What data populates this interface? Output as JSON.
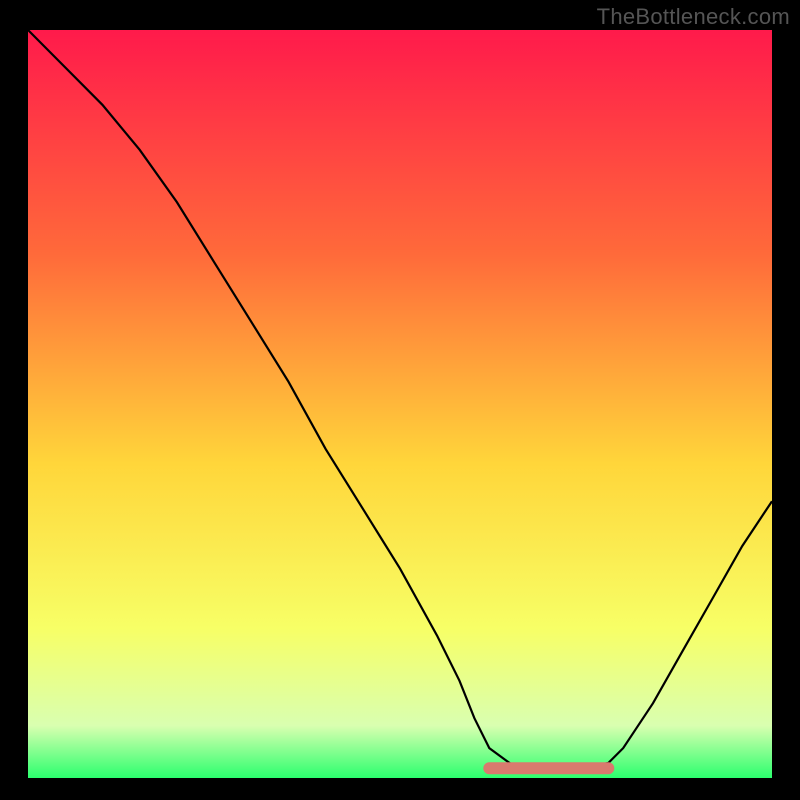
{
  "attribution": "TheBottleneck.com",
  "chart_data": {
    "type": "line",
    "title": "",
    "xlabel": "",
    "ylabel": "",
    "xlim": [
      0,
      100
    ],
    "ylim": [
      0,
      100
    ],
    "background_gradient": {
      "top": "#ff1a4b",
      "upper_mid": "#ff6a3a",
      "mid": "#ffd63a",
      "lower_mid": "#f7ff66",
      "lower": "#d9ffb0",
      "bottom": "#2bff6e"
    },
    "curve_color": "#000000",
    "highlight": {
      "color": "#d97a6e",
      "x_start": 62,
      "x_end": 78,
      "y": 1.3
    },
    "series": [
      {
        "name": "bottleneck-curve",
        "x": [
          0,
          5,
          10,
          15,
          20,
          25,
          30,
          35,
          40,
          45,
          50,
          55,
          58,
          60,
          62,
          65,
          68,
          72,
          75,
          78,
          80,
          84,
          88,
          92,
          96,
          100
        ],
        "y": [
          100,
          95,
          90,
          84,
          77,
          69,
          61,
          53,
          44,
          36,
          28,
          19,
          13,
          8,
          4,
          1.8,
          1.3,
          1.3,
          1.4,
          2,
          4,
          10,
          17,
          24,
          31,
          37
        ]
      }
    ]
  }
}
